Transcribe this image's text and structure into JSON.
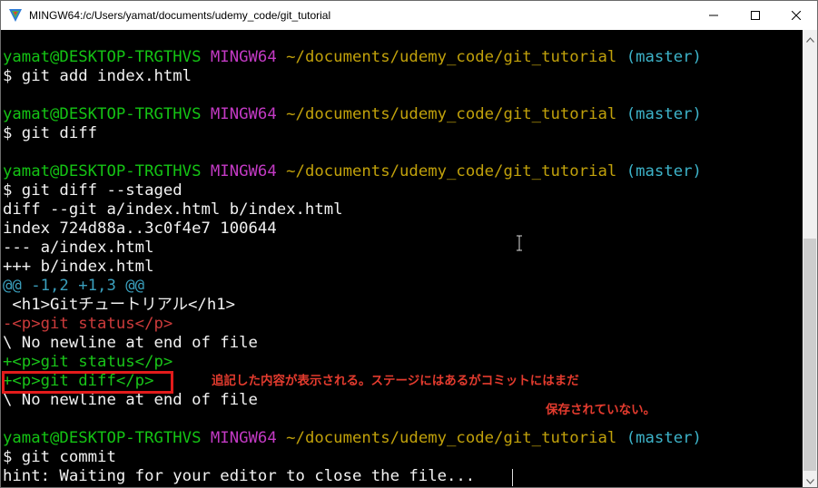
{
  "window": {
    "title": "MINGW64:/c/Users/yamat/documents/udemy_code/git_tutorial",
    "icon": "mingw-terminal-icon",
    "controls": [
      "minimize-icon",
      "maximize-icon",
      "close-icon"
    ]
  },
  "terminal": {
    "prompts": [
      {
        "user": "yamat@DESKTOP-TRGTHVS",
        "env": "MINGW64",
        "path": "~/documents/udemy_code/git_tutorial",
        "branch": "(master)",
        "command": "$ git add index.html"
      },
      {
        "user": "yamat@DESKTOP-TRGTHVS",
        "env": "MINGW64",
        "path": "~/documents/udemy_code/git_tutorial",
        "branch": "(master)",
        "command": "$ git diff"
      },
      {
        "user": "yamat@DESKTOP-TRGTHVS",
        "env": "MINGW64",
        "path": "~/documents/udemy_code/git_tutorial",
        "branch": "(master)",
        "command": "$ git diff --staged"
      },
      {
        "user": "yamat@DESKTOP-TRGTHVS",
        "env": "MINGW64",
        "path": "~/documents/udemy_code/git_tutorial",
        "branch": "(master)",
        "command": "$ git commit"
      }
    ],
    "diff_output": {
      "header": "diff --git a/index.html b/index.html",
      "index": "index 724d88a..3c0f4e7 100644",
      "from_file": "--- a/index.html",
      "to_file": "+++ b/index.html",
      "hunk": "@@ -1,2 +1,3 @@",
      "context": " <h1>Gitチュートリアル</h1>",
      "removed": "-<p>git status</p>",
      "no_newline_1": "\\ No newline at end of file",
      "added_1": "+<p>git status</p>",
      "added_2": "+<p>git diff</p>",
      "no_newline_2": "\\ No newline at end of file"
    },
    "hint": "hint: Waiting for your editor to close the file... "
  },
  "annotation": {
    "line1": "追記した内容が表示される。ステージにはあるがコミットにはまだ",
    "line2": "保存されていない。",
    "color": "#e33b2e"
  },
  "colors": {
    "user": "#14c414",
    "env": "#c33ac4",
    "path": "#c1a10b",
    "branch": "#3db3c9",
    "removed": "#cc3b3b",
    "added": "#19c419",
    "hunk": "#3a9fbd",
    "highlight_box": "#e31b1b"
  }
}
